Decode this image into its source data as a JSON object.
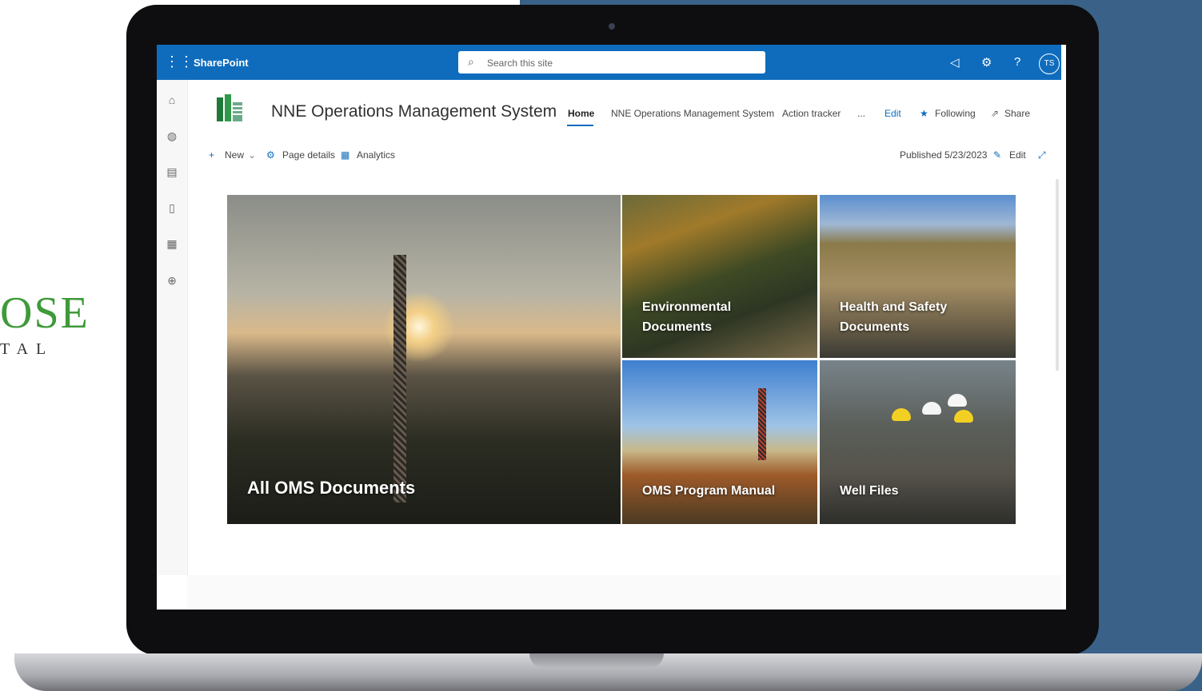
{
  "background": {
    "logo_text": "OSE",
    "logo_subtext": "TAL",
    "brand_color": "#3f9a3a",
    "panel_color": "#3a6289"
  },
  "suitebar": {
    "app_name": "SharePoint",
    "search_placeholder": "Search this site",
    "avatar_initials": "TS",
    "icons": [
      "waffle-icon",
      "megaphone-icon",
      "settings-icon",
      "help-icon"
    ],
    "accent": "#0f6cbd"
  },
  "leftnav": {
    "icons": [
      "home-icon",
      "globe-icon",
      "news-icon",
      "document-icon",
      "database-icon",
      "add-icon"
    ]
  },
  "site": {
    "title": "NNE Operations Management System",
    "nav": [
      "Home",
      "NNE Operations Management System",
      "Action tracker",
      "...",
      "Edit"
    ],
    "following_label": "Following",
    "share_label": "Share"
  },
  "commandbar": {
    "new_label": "New",
    "page_details_label": "Page details",
    "analytics_label": "Analytics",
    "published_label": "Published 5/23/2023",
    "edit_label": "Edit"
  },
  "tiles": [
    {
      "label": "All OMS Documents"
    },
    {
      "label": "Environmental Documents"
    },
    {
      "label": "Health and Safety Documents"
    },
    {
      "label": "OMS Program Manual"
    },
    {
      "label": "Well Files"
    }
  ]
}
